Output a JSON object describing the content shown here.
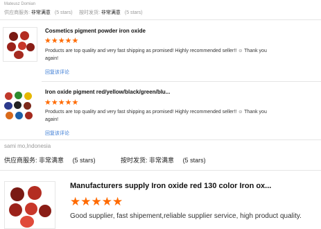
{
  "reviews": [
    {
      "reviewer": "Mateusz Domian",
      "supplier_service_label": "供应商服务:",
      "supplier_service_value": "非常满意",
      "supplier_service_stars": "(5 stars)",
      "shipping_label": "按时发货:",
      "shipping_value": "非常满意",
      "shipping_stars": "(5 stars)",
      "products": [
        {
          "title": "Cosmetics pigment powder iron oxide",
          "stars": "★★★★★",
          "rating": 5,
          "text": "Products are top quality and very fast shipping as promised! Highly recommended seller!! ☺ Thank you again!",
          "reply": "回复该评论"
        },
        {
          "title": "Iron oxide pigment red/yellow/black/green/blu...",
          "stars": "★★★★★",
          "rating": 5,
          "text": "Products are top quality and very fast shipping as promised! Highly recommended seller!! ☺ Thank you again!",
          "reply": "回复该评论"
        }
      ]
    },
    {
      "reviewer": "sami mo,Indonesia",
      "supplier_service_label": "供应商服务:",
      "supplier_service_value": "非常满意",
      "supplier_service_stars": "(5 stars)",
      "shipping_label": "按时发货:",
      "shipping_value": "非常满意",
      "shipping_stars": "(5 stars)",
      "products": [
        {
          "title": "Manufacturers supply Iron oxide red 130 color Iron ox...",
          "stars": "★★★★★",
          "rating": 5,
          "text": "Good supplier, fast shipement,reliable supplier service, high product quality."
        }
      ]
    }
  ],
  "colors": {
    "star": "#ff6a00",
    "link": "#3a7bd5",
    "divider": "#e5e5e5"
  }
}
